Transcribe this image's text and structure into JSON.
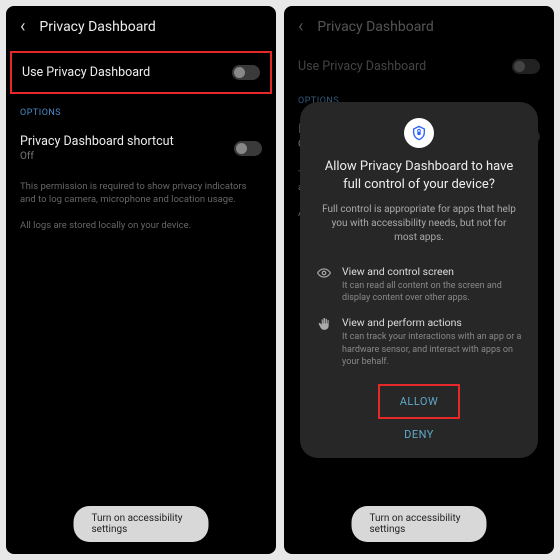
{
  "left": {
    "title": "Privacy Dashboard",
    "useToggle": "Use Privacy Dashboard",
    "optionsHeader": "OPTIONS",
    "shortcut": "Privacy Dashboard shortcut",
    "shortcutState": "Off",
    "permDesc": "This permission is required to show privacy indicators and to log camera, microphone and location usage.",
    "logsDesc": "All logs are stored locally on your device.",
    "pill": "Turn on accessibility settings"
  },
  "right": {
    "title": "Privacy Dashboard",
    "useToggle": "Use Privacy Dashboard",
    "optionsHeader": "OPTIONS",
    "shortcut": "Privacy Dashboard shortcut",
    "shortcutState": "Off",
    "permDesc": "This permission is required to show privacy indicators and to log camera, microphone and location usage.",
    "logsDesc": "All logs are stored locally on your device.",
    "pill": "Turn on accessibility settings",
    "dialog": {
      "title": "Allow Privacy Dashboard to have full control of your device?",
      "desc": "Full control is appropriate for apps that help you with accessibility needs, but not for most apps.",
      "perm1t": "View and control screen",
      "perm1d": "It can read all content on the screen and display content over other apps.",
      "perm2t": "View and perform actions",
      "perm2d": "It can track your interactions with an app or a hardware sensor, and interact with apps on your behalf.",
      "allow": "ALLOW",
      "deny": "DENY"
    }
  }
}
